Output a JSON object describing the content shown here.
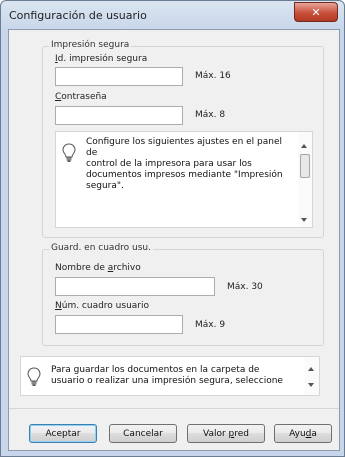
{
  "window": {
    "title": "Configuración de usuario",
    "close_glyph": "✕"
  },
  "secure_print": {
    "group_title": "Impresión segura",
    "id_label_accel": "I",
    "id_label_rest": "d. impresión segura",
    "id_value": "",
    "id_max": "Máx. 16",
    "password_label_accel": "C",
    "password_label_rest": "ontraseña",
    "password_value": "",
    "password_max": "Máx. 8",
    "note_line1": "Configure los siguientes ajustes en el panel de",
    "note_line2": "control de la impresora para usar los",
    "note_line3": "documentos impresos mediante \"Impresión",
    "note_line4": "segura\"."
  },
  "user_box": {
    "group_title": "Guard. en cuadro usu.",
    "filename_label_pre": "Nombre de ",
    "filename_label_accel": "a",
    "filename_label_post": "rchivo",
    "filename_value": "",
    "filename_max": "Máx. 30",
    "boxnum_label_accel": "N",
    "boxnum_label_rest": "úm. cuadro usuario",
    "boxnum_value": "",
    "boxnum_max": "Máx. 9"
  },
  "bottom_note": {
    "line1": "Para guardar los documentos en la carpeta de",
    "line2": "usuario o realizar una impresión segura, seleccione"
  },
  "buttons": {
    "ok": "Aceptar",
    "cancel": "Cancelar",
    "default_pre": "Valor ",
    "default_accel": "p",
    "default_post": "red",
    "help_pre": "Ayu",
    "help_accel": "d",
    "help_post": "a"
  }
}
